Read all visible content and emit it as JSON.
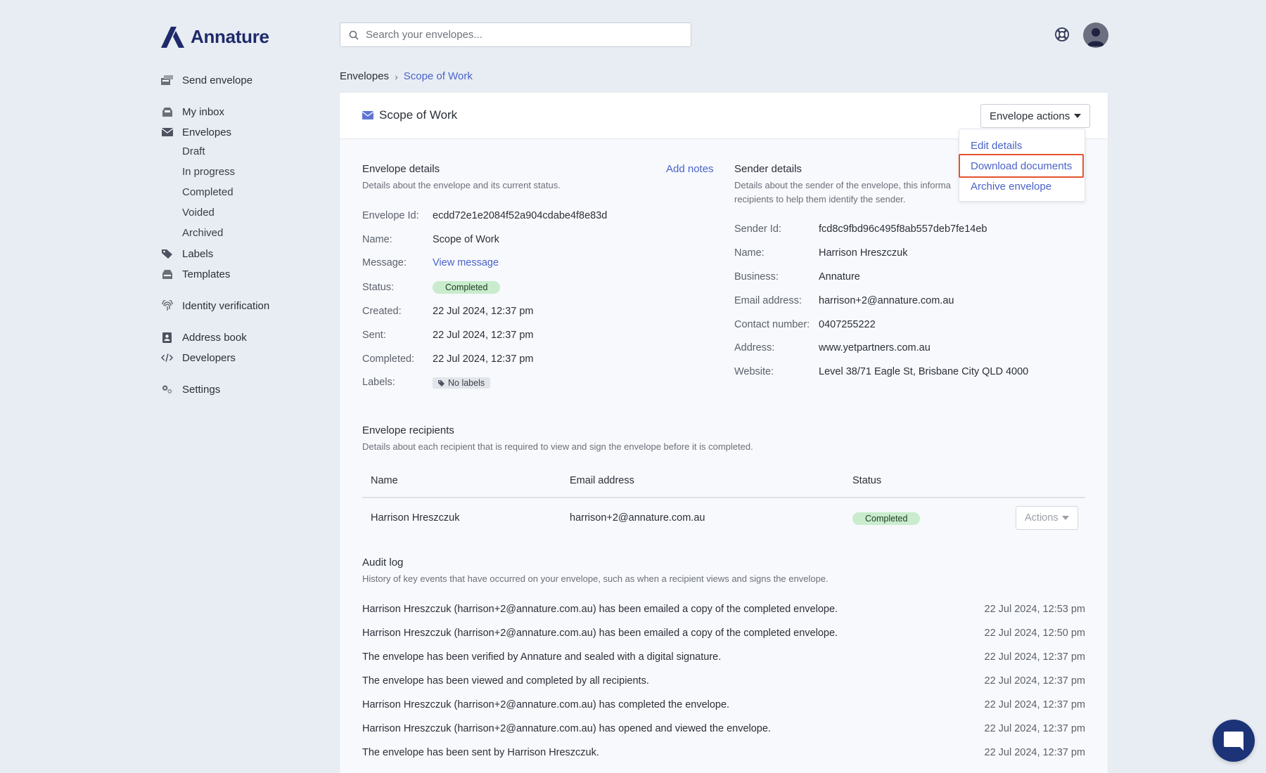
{
  "app": {
    "logo_text": "Annature"
  },
  "search": {
    "placeholder": "Search your envelopes..."
  },
  "sidebar": {
    "send_envelope": "Send envelope",
    "my_inbox": "My inbox",
    "envelopes": "Envelopes",
    "sub": [
      "Draft",
      "In progress",
      "Completed",
      "Voided",
      "Archived"
    ],
    "labels": "Labels",
    "templates": "Templates",
    "identity_verification": "Identity verification",
    "address_book": "Address book",
    "developers": "Developers",
    "settings": "Settings"
  },
  "breadcrumb": {
    "root": "Envelopes",
    "current": "Scope of Work"
  },
  "card": {
    "title": "Scope of Work",
    "envelope_actions_label": "Envelope actions",
    "dropdown": [
      "Edit details",
      "Download documents",
      "Archive envelope"
    ]
  },
  "envelope_details": {
    "title": "Envelope details",
    "add_notes": "Add notes",
    "description": "Details about the envelope and its current status.",
    "fields": [
      {
        "label": "Envelope Id:",
        "value": "ecdd72e1e2084f52a904cdabe4f8e83d"
      },
      {
        "label": "Name:",
        "value": "Scope of Work"
      },
      {
        "label": "Message:",
        "value": "View message"
      },
      {
        "label": "Status:",
        "value": "Completed"
      },
      {
        "label": "Created:",
        "value": "22 Jul 2024, 12:37 pm"
      },
      {
        "label": "Sent:",
        "value": "22 Jul 2024, 12:37 pm"
      },
      {
        "label": "Completed:",
        "value": "22 Jul 2024, 12:37 pm"
      },
      {
        "label": "Labels:",
        "value": "No labels"
      }
    ]
  },
  "sender_details": {
    "title": "Sender details",
    "description_line1": "Details about the sender of the envelope, this informa",
    "description_line2": "recipients to help them identify the sender.",
    "fields": [
      {
        "label": "Sender Id:",
        "value": "fcd8c9fbd96c495f8ab557deb7fe14eb"
      },
      {
        "label": "Name:",
        "value": "Harrison Hreszczuk"
      },
      {
        "label": "Business:",
        "value": "Annature"
      },
      {
        "label": "Email address:",
        "value": "harrison+2@annature.com.au"
      },
      {
        "label": "Contact number:",
        "value": "0407255222"
      },
      {
        "label": "Address:",
        "value": "www.yetpartners.com.au"
      },
      {
        "label": "Website:",
        "value": "Level 38/71 Eagle St, Brisbane City QLD 4000"
      }
    ]
  },
  "recipients": {
    "title": "Envelope recipients",
    "description": "Details about each recipient that is required to view and sign the envelope before it is completed.",
    "columns": [
      "Name",
      "Email address",
      "Status"
    ],
    "rows": [
      {
        "name": "Harrison Hreszczuk",
        "email": "harrison+2@annature.com.au",
        "status": "Completed",
        "action": "Actions"
      }
    ]
  },
  "audit_log": {
    "title": "Audit log",
    "description": "History of key events that have occurred on your envelope, such as when a recipient views and signs the envelope.",
    "events": [
      {
        "text": "Harrison Hreszczuk (harrison+2@annature.com.au) has been emailed a copy of the completed envelope.",
        "time": "22 Jul 2024, 12:53 pm"
      },
      {
        "text": "Harrison Hreszczuk (harrison+2@annature.com.au) has been emailed a copy of the completed envelope.",
        "time": "22 Jul 2024, 12:50 pm"
      },
      {
        "text": "The envelope has been verified by Annature and sealed with a digital signature.",
        "time": "22 Jul 2024, 12:37 pm"
      },
      {
        "text": "The envelope has been viewed and completed by all recipients.",
        "time": "22 Jul 2024, 12:37 pm"
      },
      {
        "text": "Harrison Hreszczuk (harrison+2@annature.com.au) has completed the envelope.",
        "time": "22 Jul 2024, 12:37 pm"
      },
      {
        "text": "Harrison Hreszczuk (harrison+2@annature.com.au) has opened and viewed the envelope.",
        "time": "22 Jul 2024, 12:37 pm"
      },
      {
        "text": "The envelope has been sent by Harrison Hreszczuk.",
        "time": "22 Jul 2024, 12:37 pm"
      }
    ]
  },
  "colors": {
    "accent": "#4a63c9",
    "brand": "#1f2a6b",
    "success_bg": "#c9eccd",
    "highlight": "#e5532d"
  }
}
